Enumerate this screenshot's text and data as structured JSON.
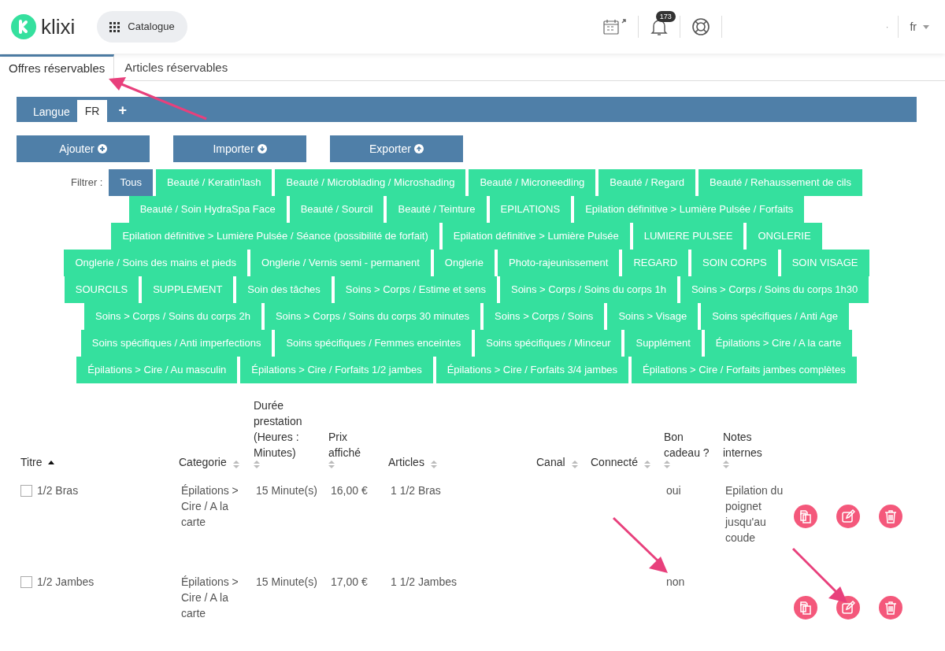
{
  "header": {
    "logo": "klixi",
    "catalogue_button": "Catalogue",
    "notification_count": "173",
    "separator_dot": "·",
    "language": "fr"
  },
  "tabs": [
    {
      "label": "Offres réservables",
      "selected": true
    },
    {
      "label": "Articles réservables",
      "selected": false
    }
  ],
  "language_bar": {
    "label": "Langue",
    "languages": [
      {
        "label": "FR",
        "selected": true
      }
    ],
    "add": "+"
  },
  "actions": [
    "Ajouter",
    "Importer",
    "Exporter"
  ],
  "filter": {
    "label": "Filtrer :",
    "tags": [
      {
        "label": "Tous",
        "selected": true
      },
      {
        "label": "Beauté / Keratin'lash",
        "selected": false
      },
      {
        "label": "Beauté / Microblading / Microshading",
        "selected": false
      },
      {
        "label": "Beauté / Microneedling",
        "selected": false
      },
      {
        "label": "Beauté / Regard",
        "selected": false
      },
      {
        "label": "Beauté / Rehaussement de cils",
        "selected": false
      },
      {
        "label": "Beauté / Soin HydraSpa Face",
        "selected": false
      },
      {
        "label": "Beauté / Sourcil",
        "selected": false
      },
      {
        "label": "Beauté / Teinture",
        "selected": false
      },
      {
        "label": "EPILATIONS",
        "selected": false
      },
      {
        "label": "Epilation définitive > Lumière Pulsée / Forfaits",
        "selected": false
      },
      {
        "label": "Epilation définitive > Lumière Pulsée / Séance (possibilité de forfait)",
        "selected": false
      },
      {
        "label": "Epilation définitive > Lumière Pulsée",
        "selected": false
      },
      {
        "label": "LUMIERE PULSEE",
        "selected": false
      },
      {
        "label": "ONGLERIE",
        "selected": false
      },
      {
        "label": "Onglerie / Soins des mains et pieds",
        "selected": false
      },
      {
        "label": "Onglerie / Vernis semi - permanent",
        "selected": false
      },
      {
        "label": "Onglerie",
        "selected": false
      },
      {
        "label": "Photo-rajeunissement",
        "selected": false
      },
      {
        "label": "REGARD",
        "selected": false
      },
      {
        "label": "SOIN CORPS",
        "selected": false
      },
      {
        "label": "SOIN VISAGE",
        "selected": false
      },
      {
        "label": "SOURCILS",
        "selected": false
      },
      {
        "label": "SUPPLEMENT",
        "selected": false
      },
      {
        "label": "Soin des tâches",
        "selected": false
      },
      {
        "label": "Soins > Corps / Estime et sens",
        "selected": false
      },
      {
        "label": "Soins > Corps / Soins du corps 1h",
        "selected": false
      },
      {
        "label": "Soins > Corps / Soins du corps 1h30",
        "selected": false
      },
      {
        "label": "Soins > Corps / Soins du corps 2h",
        "selected": false
      },
      {
        "label": "Soins > Corps / Soins du corps 30 minutes",
        "selected": false
      },
      {
        "label": "Soins > Corps / Soins",
        "selected": false
      },
      {
        "label": "Soins > Visage",
        "selected": false
      },
      {
        "label": "Soins spécifiques / Anti Age",
        "selected": false
      },
      {
        "label": "Soins spécifiques / Anti imperfections",
        "selected": false
      },
      {
        "label": "Soins spécifiques / Femmes enceintes",
        "selected": false
      },
      {
        "label": "Soins spécifiques / Minceur",
        "selected": false
      },
      {
        "label": "Supplément",
        "selected": false
      },
      {
        "label": "Épilations > Cire / A la carte",
        "selected": false
      },
      {
        "label": "Épilations > Cire / Au masculin",
        "selected": false
      },
      {
        "label": "Épilations > Cire / Forfaits 1/2 jambes",
        "selected": false
      },
      {
        "label": "Épilations > Cire / Forfaits 3/4 jambes",
        "selected": false
      },
      {
        "label": "Épilations > Cire / Forfaits jambes complètes",
        "selected": false
      }
    ]
  },
  "table": {
    "columns": [
      {
        "label": "Titre",
        "sorted": true
      },
      {
        "label": "Categorie",
        "sorted": false
      },
      {
        "label": "Durée prestation (Heures : Minutes)",
        "sorted": false
      },
      {
        "label": "Prix affiché",
        "sorted": false
      },
      {
        "label": "Articles",
        "sorted": false
      },
      {
        "label": "Canal",
        "sorted": false
      },
      {
        "label": "Connecté",
        "sorted": false
      },
      {
        "label": "Bon cadeau ?",
        "sorted": false
      },
      {
        "label": "Notes internes",
        "sorted": false
      }
    ],
    "rows": [
      {
        "checked": false,
        "cells": [
          "1/2 Bras",
          "Épilations > Cire / A la carte",
          "15 Minute(s)",
          "16,00 €",
          "1 1/2 Bras",
          "",
          "",
          "oui",
          "Epilation du poignet jusqu'au coude"
        ]
      },
      {
        "checked": false,
        "cells": [
          "1/2 Jambes",
          "Épilations > Cire / A la carte",
          "15 Minute(s)",
          "17,00 €",
          "1 1/2 Jambes",
          "",
          "",
          "non",
          ""
        ]
      }
    ]
  }
}
